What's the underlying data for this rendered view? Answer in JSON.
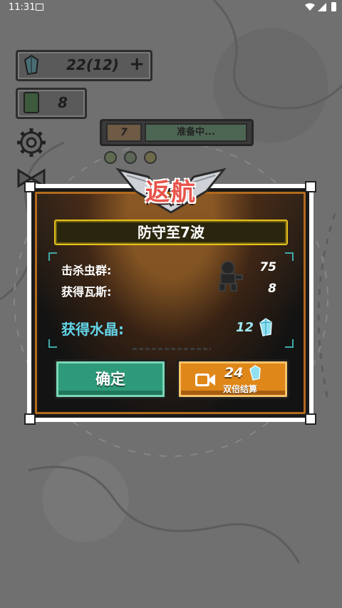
{
  "status_bar": {
    "time": "11:31"
  },
  "hud": {
    "crystals": "22(12)",
    "crystals_plus": "+",
    "gas": "8",
    "wave_number": "7",
    "prep_status": "准备中..."
  },
  "dialog": {
    "title": "返航",
    "wave_banner": "防守至7波",
    "stats": [
      {
        "label": "击杀虫群:",
        "value": "75"
      },
      {
        "label": "获得瓦斯:",
        "value": "8"
      }
    ],
    "crystal_label": "获得水晶:",
    "crystal_value": "12",
    "confirm_label": "确定",
    "double_amount": "24",
    "double_label": "双倍结算"
  },
  "colors": {
    "accent_green": "#2e9a7a",
    "accent_orange": "#df8719",
    "title_red": "#e8534a",
    "crystal_cyan": "#63d6ea",
    "banner_gold": "#e6c21a"
  }
}
